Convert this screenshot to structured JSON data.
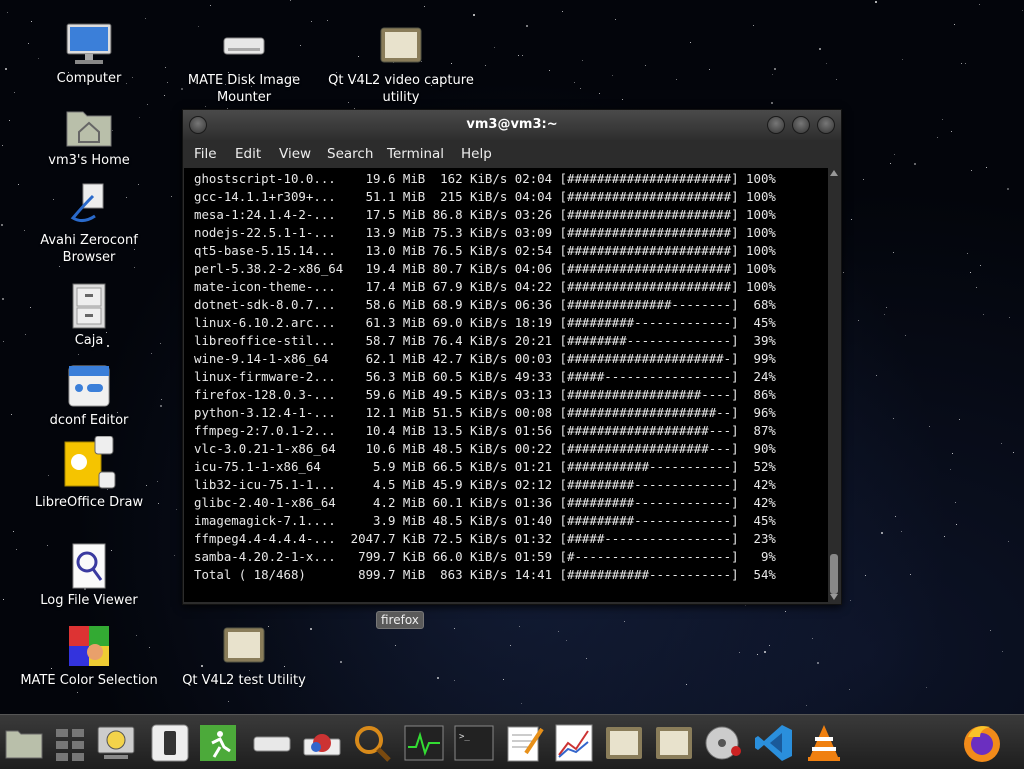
{
  "desktop": {
    "icons": [
      {
        "label": "Computer",
        "icon": "computer-icon"
      },
      {
        "label": "vm3's Home",
        "icon": "home-folder-icon"
      },
      {
        "label": "Avahi Zeroconf Browser",
        "icon": "network-icon"
      },
      {
        "label": "Caja",
        "icon": "file-cabinet-icon"
      },
      {
        "label": "dconf Editor",
        "icon": "settings-editor-icon"
      },
      {
        "label": "LibreOffice Draw",
        "icon": "libreoffice-draw-icon"
      },
      {
        "label": "Log File Viewer",
        "icon": "log-viewer-icon"
      },
      {
        "label": "MATE Color Selection",
        "icon": "color-selection-icon"
      },
      {
        "label": "MATE Disk Image Mounter",
        "icon": "disk-image-icon"
      },
      {
        "label": "Qt V4L2 video capture utility",
        "icon": "video-capture-icon"
      },
      {
        "label": "Qt V4L2 test Utility",
        "icon": "video-test-icon"
      }
    ]
  },
  "terminal": {
    "title": "vm3@vm3:~",
    "menu": [
      "File",
      "Edit",
      "View",
      "Search",
      "Terminal",
      "Help"
    ],
    "rows": [
      {
        "name": "ghostscript-10.0...",
        "size": "19.6 MiB",
        "speed": "162 KiB/s",
        "time": "02:04",
        "bar": "[######################]",
        "pct": "100%"
      },
      {
        "name": "gcc-14.1.1+r309+...",
        "size": "51.1 MiB",
        "speed": "215 KiB/s",
        "time": "04:04",
        "bar": "[######################]",
        "pct": "100%"
      },
      {
        "name": "mesa-1:24.1.4-2-...",
        "size": "17.5 MiB",
        "speed": "86.8 KiB/s",
        "time": "03:26",
        "bar": "[######################]",
        "pct": "100%"
      },
      {
        "name": "nodejs-22.5.1-1-...",
        "size": "13.9 MiB",
        "speed": "75.3 KiB/s",
        "time": "03:09",
        "bar": "[######################]",
        "pct": "100%"
      },
      {
        "name": "qt5-base-5.15.14...",
        "size": "13.0 MiB",
        "speed": "76.5 KiB/s",
        "time": "02:54",
        "bar": "[######################]",
        "pct": "100%"
      },
      {
        "name": "perl-5.38.2-2-x86_64",
        "size": "19.4 MiB",
        "speed": "80.7 KiB/s",
        "time": "04:06",
        "bar": "[######################]",
        "pct": "100%"
      },
      {
        "name": "mate-icon-theme-...",
        "size": "17.4 MiB",
        "speed": "67.9 KiB/s",
        "time": "04:22",
        "bar": "[######################]",
        "pct": "100%"
      },
      {
        "name": "dotnet-sdk-8.0.7...",
        "size": "58.6 MiB",
        "speed": "68.9 KiB/s",
        "time": "06:36",
        "bar": "[##############--------]",
        "pct": "68%"
      },
      {
        "name": "linux-6.10.2.arc...",
        "size": "61.3 MiB",
        "speed": "69.0 KiB/s",
        "time": "18:19",
        "bar": "[#########-------------]",
        "pct": "45%"
      },
      {
        "name": "libreoffice-stil...",
        "size": "58.7 MiB",
        "speed": "76.4 KiB/s",
        "time": "20:21",
        "bar": "[########--------------]",
        "pct": "39%"
      },
      {
        "name": "wine-9.14-1-x86_64",
        "size": "62.1 MiB",
        "speed": "42.7 KiB/s",
        "time": "00:03",
        "bar": "[#####################-]",
        "pct": "99%"
      },
      {
        "name": "linux-firmware-2...",
        "size": "56.3 MiB",
        "speed": "60.5 KiB/s",
        "time": "49:33",
        "bar": "[#####-----------------]",
        "pct": "24%"
      },
      {
        "name": "firefox-128.0.3-...",
        "size": "59.6 MiB",
        "speed": "49.5 KiB/s",
        "time": "03:13",
        "bar": "[##################----]",
        "pct": "86%"
      },
      {
        "name": "python-3.12.4-1-...",
        "size": "12.1 MiB",
        "speed": "51.5 KiB/s",
        "time": "00:08",
        "bar": "[####################--]",
        "pct": "96%"
      },
      {
        "name": "ffmpeg-2:7.0.1-2...",
        "size": "10.4 MiB",
        "speed": "13.5 KiB/s",
        "time": "01:56",
        "bar": "[###################---]",
        "pct": "87%"
      },
      {
        "name": "vlc-3.0.21-1-x86_64",
        "size": "10.6 MiB",
        "speed": "48.5 KiB/s",
        "time": "00:22",
        "bar": "[###################---]",
        "pct": "90%"
      },
      {
        "name": "icu-75.1-1-x86_64",
        "size": "5.9 MiB",
        "speed": "66.5 KiB/s",
        "time": "01:21",
        "bar": "[###########-----------]",
        "pct": "52%"
      },
      {
        "name": "lib32-icu-75.1-1...",
        "size": "4.5 MiB",
        "speed": "45.9 KiB/s",
        "time": "02:12",
        "bar": "[#########-------------]",
        "pct": "42%"
      },
      {
        "name": "glibc-2.40-1-x86_64",
        "size": "4.2 MiB",
        "speed": "60.1 KiB/s",
        "time": "01:36",
        "bar": "[#########-------------]",
        "pct": "42%"
      },
      {
        "name": "imagemagick-7.1....",
        "size": "3.9 MiB",
        "speed": "48.5 KiB/s",
        "time": "01:40",
        "bar": "[#########-------------]",
        "pct": "45%"
      },
      {
        "name": "ffmpeg4.4-4.4.4-...",
        "size": "2047.7 KiB",
        "speed": "72.5 KiB/s",
        "time": "01:32",
        "bar": "[#####-----------------]",
        "pct": "23%"
      },
      {
        "name": "samba-4.20.2-1-x...",
        "size": "799.7 KiB",
        "speed": "66.0 KiB/s",
        "time": "01:59",
        "bar": "[#---------------------]",
        "pct": "9%"
      },
      {
        "name": "Total ( 18/468)",
        "size": "899.7 MiB",
        "speed": "863 KiB/s",
        "time": "14:41",
        "bar": "[###########-----------]",
        "pct": "54%"
      }
    ]
  },
  "tooltip": "firefox",
  "taskbar": {
    "icons": [
      "files-icon",
      "workspace-switcher-icon",
      "disk-utility-icon",
      "phone-icon",
      "exit-icon",
      "drive-icon",
      "paint-icon",
      "search-magnifier-icon",
      "system-monitor-icon",
      "terminal-icon",
      "text-editor-icon",
      "chart-icon",
      "video-capture-icon",
      "video-test-icon",
      "disk-image-icon",
      "vscode-icon",
      "vlc-icon",
      "firefox-icon"
    ]
  }
}
